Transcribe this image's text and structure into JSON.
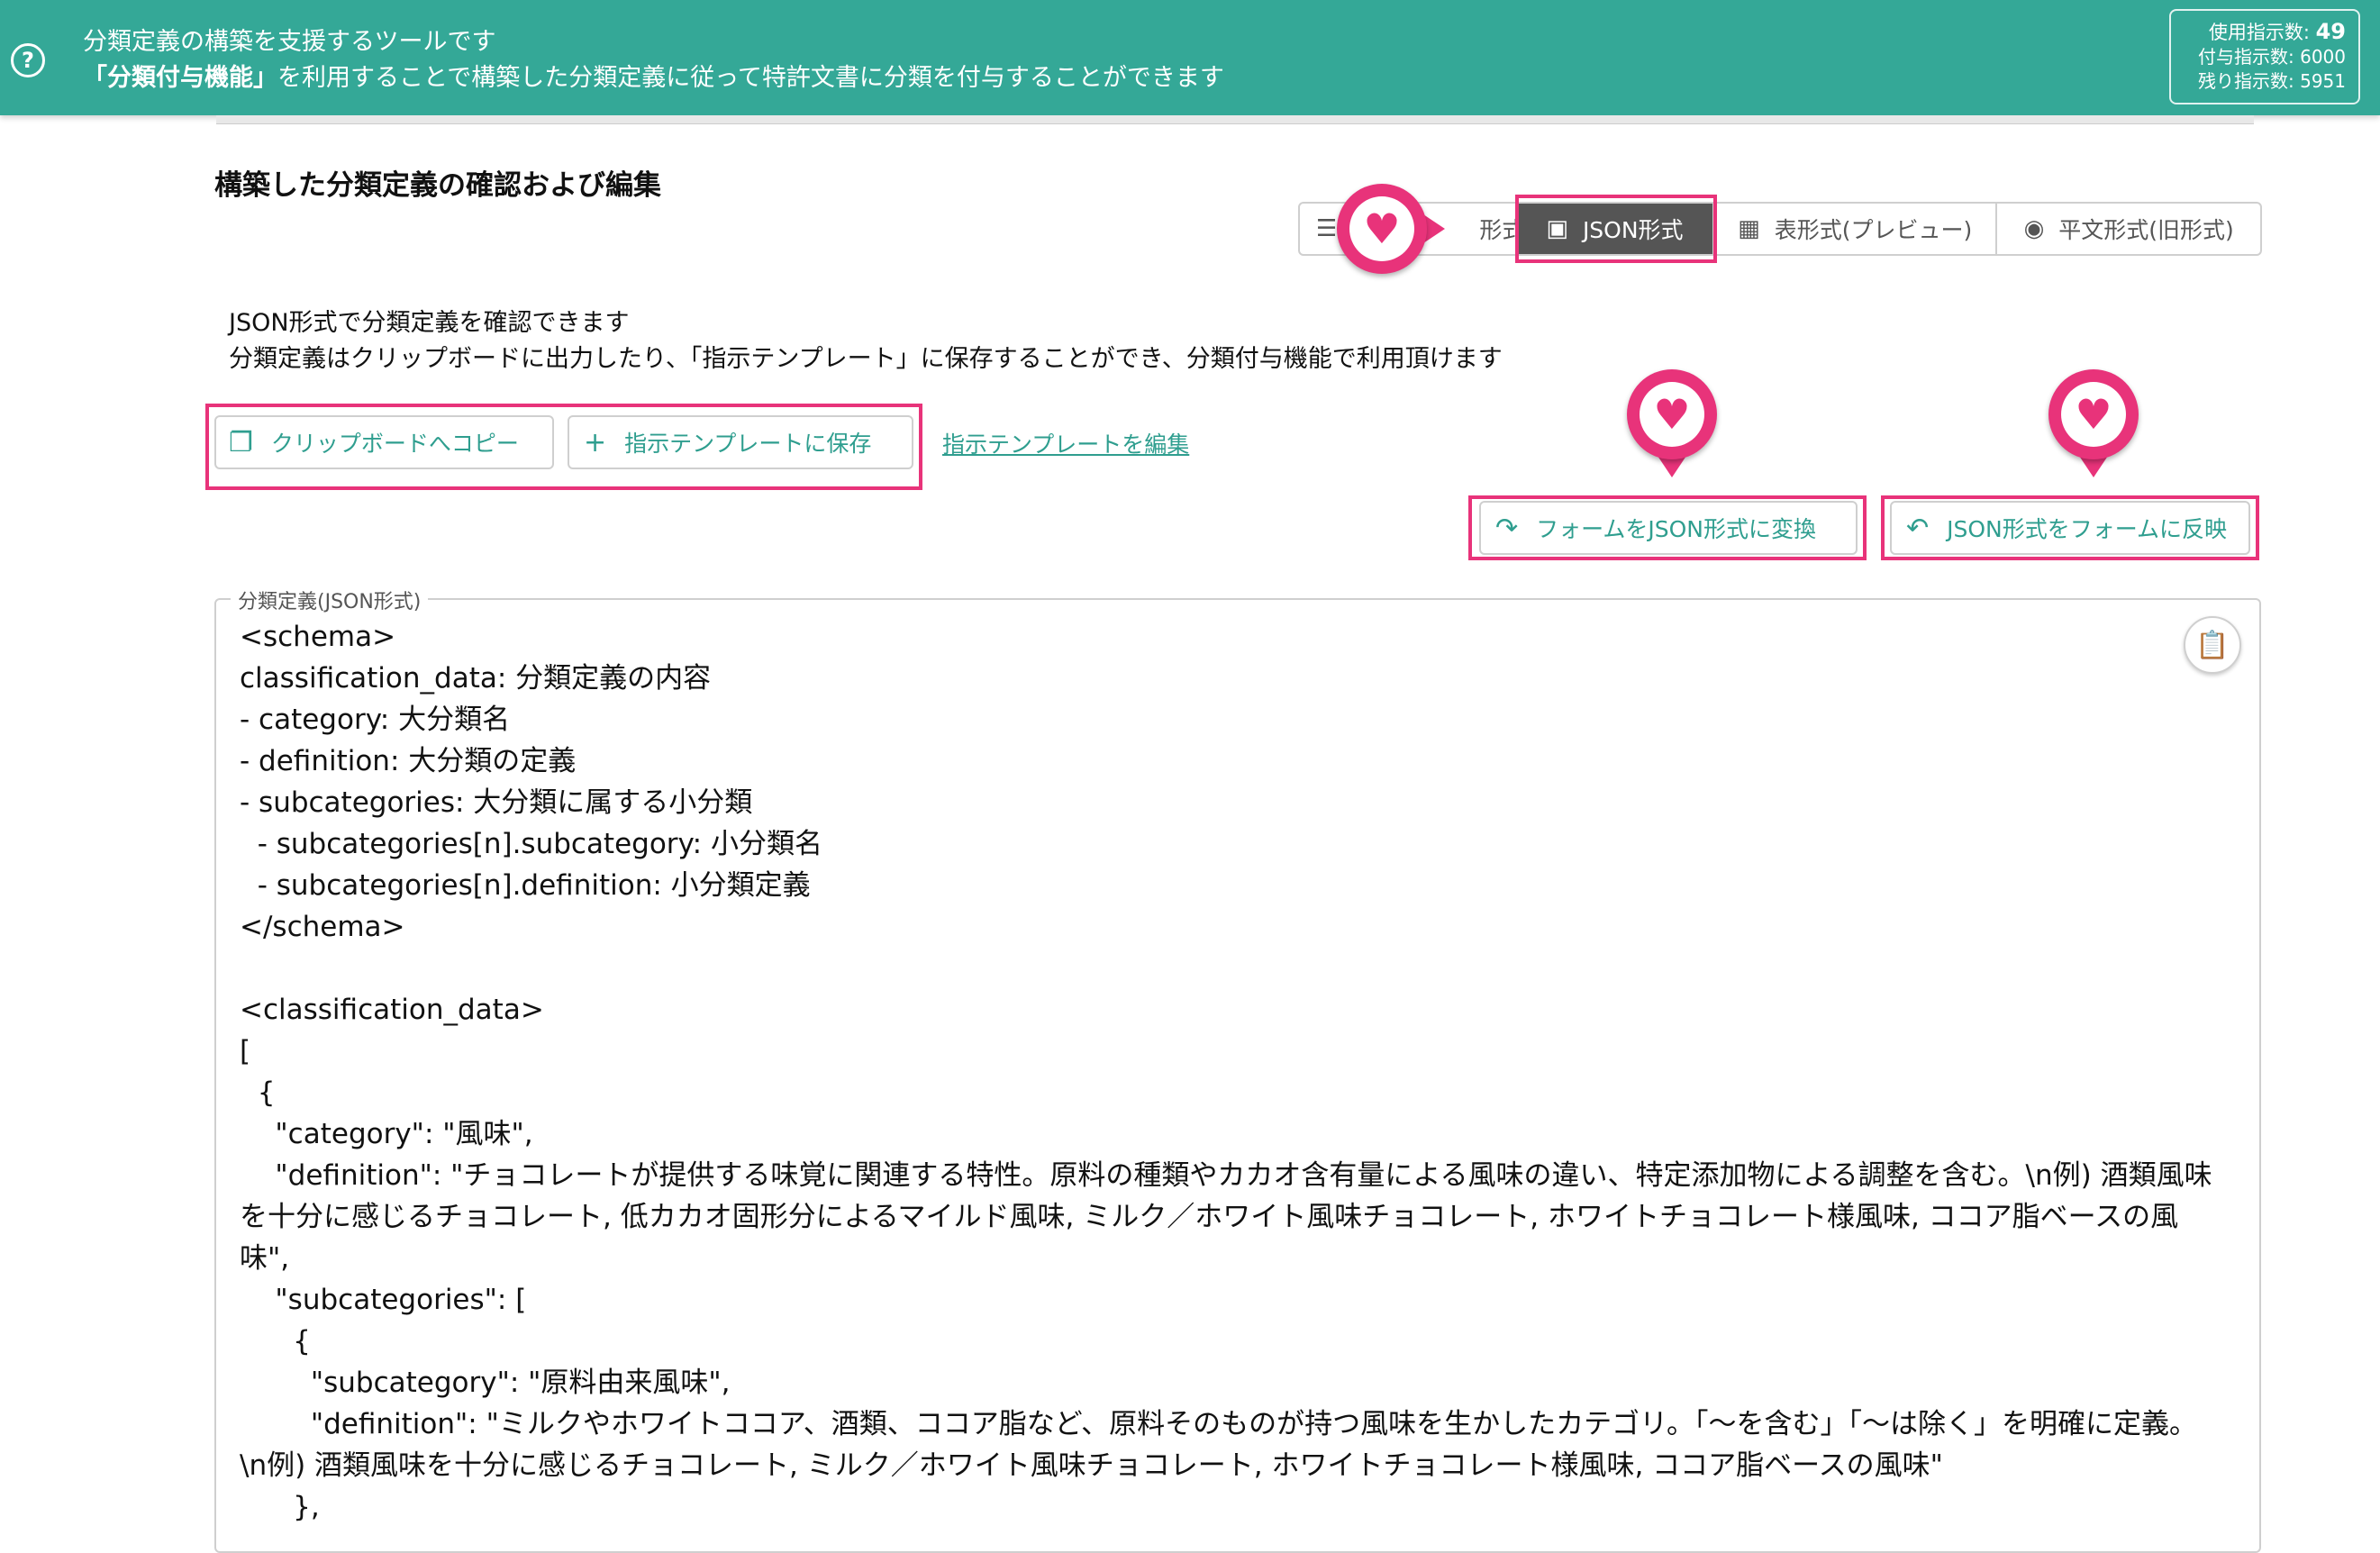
{
  "banner": {
    "help_icon": "?",
    "line1": "分類定義の構築を支援するツールです",
    "line2_bold": "「分類付与機能」",
    "line2_rest": "を利用することで構築した分類定義に従って特許文書に分類を付与することができます",
    "usage": {
      "used_label": "使用指示数:",
      "used_value": "49",
      "granted": "付与指示数: 6000",
      "remaining": "残り指示数: 5951"
    }
  },
  "section_title": "構築した分類定義の確認および編集",
  "view_toggle": {
    "form_label": "形式",
    "json_label": "JSON形式",
    "table_label": "表形式(プレビュー)",
    "plain_label": "平文形式(旧形式)"
  },
  "description": {
    "line1": "JSON形式で分類定義を確認できます",
    "line2": "分類定義はクリップボードに出力したり、「指示テンプレート」に保存することができ、分類付与機能で利用頂けます"
  },
  "actions": {
    "copy_label": "クリップボードへコピー",
    "save_label": "指示テンプレートに保存",
    "edit_link": "指示テンプレートを編集",
    "form_to_json": "フォームをJSON形式に変換",
    "json_to_form": "JSON形式をフォームに反映"
  },
  "editor": {
    "legend": "分類定義(JSON形式)",
    "content": "<schema>\nclassification_data: 分類定義の内容\n- category: 大分類名\n- definition: 大分類の定義\n- subcategories: 大分類に属する小分類\n  - subcategories[n].subcategory: 小分類名\n  - subcategories[n].definition: 小分類定義\n</schema>\n\n<classification_data>\n[\n  {\n    \"category\": \"風味\",\n    \"definition\": \"チョコレートが提供する味覚に関連する特性。原料の種類やカカオ含有量による風味の違い、特定添加物による調整を含む。\\n例) 酒類風味を十分に感じるチョコレート, 低カカオ固形分によるマイルド風味, ミルク／ホワイト風味チョコレート, ホワイトチョコレート様風味, ココア脂ベースの風味\",\n    \"subcategories\": [\n      {\n        \"subcategory\": \"原料由来風味\",\n        \"definition\": \"ミルクやホワイトココア、酒類、ココア脂など、原料そのものが持つ風味を生かしたカテゴリ。「〜を含む」「〜は除く」を明確に定義。\\n例) 酒類風味を十分に感じるチョコレート, ミルク／ホワイト風味チョコレート, ホワイトチョコレート様風味, ココア脂ベースの風味\"\n      },"
  },
  "icons": {
    "list": "list-icon",
    "terminal": "terminal-icon",
    "table": "table-icon",
    "eye": "eye-icon",
    "copy": "copy-icon",
    "plus": "plus-icon",
    "redo": "redo-icon",
    "undo": "undo-icon",
    "clipboard": "clipboard-icon",
    "heart": "heart-icon"
  },
  "colors": {
    "banner": "#34a897",
    "accent": "#2f9e8f",
    "highlight": "#e8337a",
    "active_toggle": "#555555"
  }
}
